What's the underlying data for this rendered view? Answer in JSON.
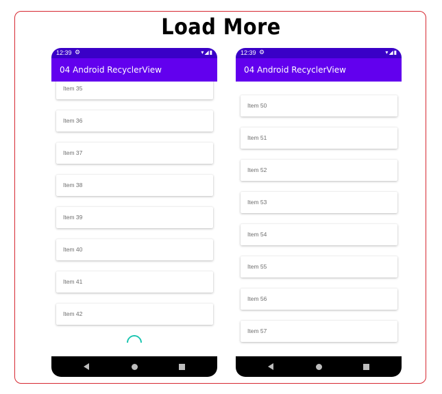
{
  "page_title": "Load More",
  "colors": {
    "frame_border": "#d6262f",
    "status_bar": "#3a00c7",
    "app_bar": "#6200ee",
    "spinner": "#1bc5b0"
  },
  "left_phone": {
    "status": {
      "time": "12:39",
      "settings_icon": "gear-icon",
      "system_icons": "wifi-icon signal-icon battery-icon"
    },
    "app_title": "04 Android RecyclerView",
    "items": [
      "Item 35",
      "Item 36",
      "Item 37",
      "Item 38",
      "Item 39",
      "Item 40",
      "Item 41",
      "Item 42"
    ],
    "loading": true,
    "nav_icons": [
      "back-icon",
      "home-icon",
      "recents-icon"
    ]
  },
  "right_phone": {
    "status": {
      "time": "12:39",
      "settings_icon": "gear-icon",
      "system_icons": "wifi-icon signal-icon battery-icon"
    },
    "app_title": "04 Android RecyclerView",
    "items": [
      "Item 50",
      "Item 51",
      "Item 52",
      "Item 53",
      "Item 54",
      "Item 55",
      "Item 56",
      "Item 57"
    ],
    "nav_icons": [
      "back-icon",
      "home-icon",
      "recents-icon"
    ]
  }
}
